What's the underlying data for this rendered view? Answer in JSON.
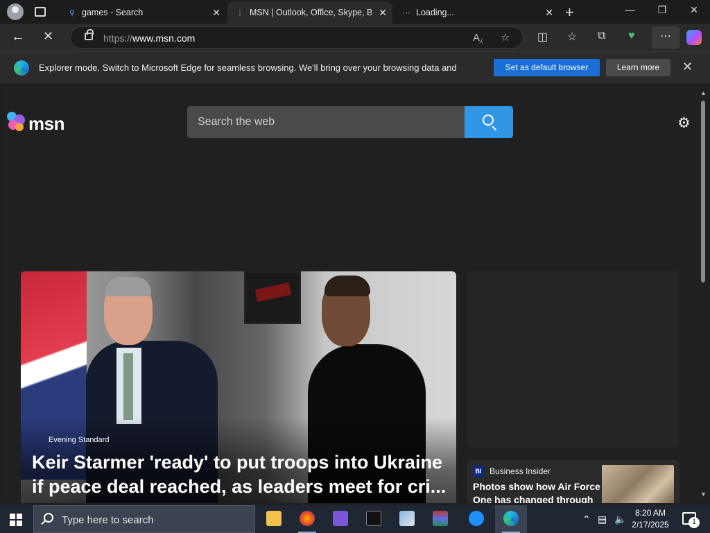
{
  "browser": {
    "tabs": [
      {
        "title": "games - Search",
        "active": false,
        "favicon": "search-icon"
      },
      {
        "title": "MSN | Outlook, Office, Skype, Bing",
        "active": true,
        "favicon": "loading-icon"
      },
      {
        "title": "Loading...",
        "active": false,
        "favicon": "loading-icon"
      }
    ],
    "address": {
      "scheme": "https://",
      "host": "www.msn.com"
    },
    "window_controls": [
      "minimize",
      "restore",
      "close"
    ]
  },
  "infobar": {
    "message": "Explorer mode. Switch to Microsoft Edge for seamless browsing. We'll bring over your browsing data and",
    "default_button": "Set as default browser",
    "learn_button": "Learn more"
  },
  "msn": {
    "logo_text": "msn",
    "search_placeholder": "Search the web"
  },
  "hero": {
    "source": "Evening Standard",
    "headline": "Keir Starmer 'ready' to put troops into Ukraine if peace deal reached, as leaders meet for cri..."
  },
  "side_card": {
    "source_badge": "BI",
    "source": "Business Insider",
    "headline": "Photos show how Air Force One has changed through"
  },
  "taskbar": {
    "search_placeholder": "Type here to search",
    "time": "8:20 AM",
    "date": "2/17/2025",
    "notification_count": "1"
  },
  "colors": {
    "accent_blue": "#1a6fd6",
    "search_button": "#3296e6",
    "page_bg": "#202020"
  }
}
